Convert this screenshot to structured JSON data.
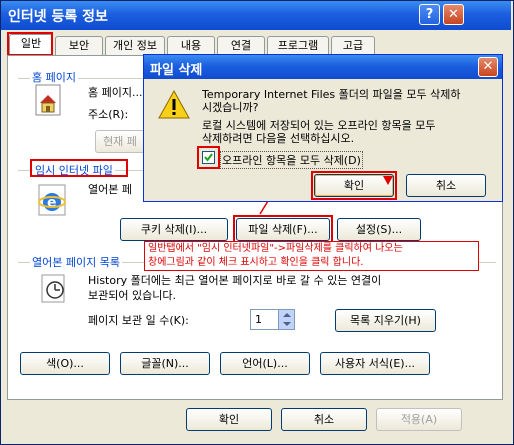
{
  "window": {
    "title": "인터넷 등록 정보",
    "help_glyph": "?",
    "close_glyph": "✕"
  },
  "tabs": [
    {
      "label": "일반",
      "active": true
    },
    {
      "label": "보안"
    },
    {
      "label": "개인 정보"
    },
    {
      "label": "내용"
    },
    {
      "label": "연결"
    },
    {
      "label": "프로그램"
    },
    {
      "label": "고급"
    }
  ],
  "home": {
    "group_title": "홈 페이지",
    "desc": "홈 페이지...",
    "address_label": "주소(R):",
    "current_btn": "현재 페"
  },
  "temp_files": {
    "group_title": "임시 인터넷 파일",
    "desc": "열어본 페",
    "cookie_btn": "쿠키 삭제(I)...",
    "delete_btn": "파일 삭제(F)...",
    "settings_btn": "설정(S)..."
  },
  "history": {
    "group_title": "열어본 페이지 목록",
    "desc_line1": "History 폴더에는 최근 열어본 페이지로 바로 갈 수 있는 연결이",
    "desc_line2": "보관되어 있습니다.",
    "days_label": "페이지 보관 일 수(K):",
    "days_value": "1",
    "clear_btn": "목록 지우기(H)"
  },
  "bottom_buttons": {
    "colors": "색(O)...",
    "fonts": "글꼴(N)...",
    "languages": "언어(L)...",
    "accessibility": "사용자 서식(E)..."
  },
  "dialog_buttons": {
    "ok": "확인",
    "cancel": "취소",
    "apply": "적용(A)"
  },
  "delete_dialog": {
    "title": "파일 삭제",
    "close_glyph": "✕",
    "line1": "Temporary Internet Files 폴더의 파일을 모두 삭제하",
    "line2": "시겠습니까?",
    "line3": "로컬 시스템에 저장되어 있는 오프라인 항목을 모두",
    "line4": "삭제하려면 다음을 선택하십시오.",
    "checkbox_label": "오프라인 항목을 모두 삭제(D)",
    "checkbox_checked": true,
    "ok": "확인",
    "cancel": "취소"
  },
  "annotation": {
    "line1": "일반탭에서 \"임시 인터넷파일\"->파일삭제를 클릭하여 나오는",
    "line2": "창에그림과 같이 체크 표시하고 확인을 클릭 합니다."
  },
  "colors": {
    "accent": "#0046d5",
    "highlight": "#e00000",
    "title_blue": "#1c5fe0"
  }
}
